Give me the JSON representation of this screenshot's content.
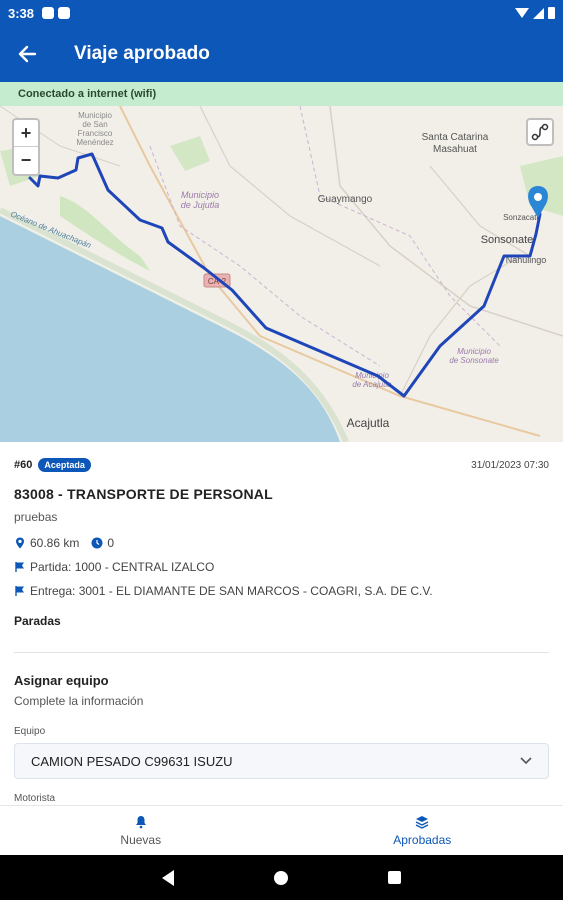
{
  "status": {
    "time": "3:38"
  },
  "header": {
    "title": "Viaje aprobado"
  },
  "connection": {
    "text": "Conectado a internet (wifi)"
  },
  "map": {
    "zoom_in": "+",
    "zoom_out": "−",
    "labels": {
      "san_francisco": "Municipio\nde San\nFrancisco\nMenéndez",
      "jujutla": "Municipio\nde Jujutla",
      "guaymango": "Guaymango",
      "santa_catarina": "Santa Catarina\nMasahuat",
      "sonzacate": "Sonzacate",
      "sonsonate": "Sonsonate",
      "nahulingo": "Nahulingo",
      "acajutla_muni": "Municipio\nde Acajutla",
      "acajutla": "Acajutla",
      "sonsonate_muni": "Municipio\nde Sonsonate",
      "ca2": "CA-2",
      "ocean": "Océano de Ahuachapán"
    }
  },
  "trip": {
    "id": "#60",
    "status": "Aceptada",
    "date": "31/01/2023 07:30",
    "title": "83008 - TRANSPORTE DE PERSONAL",
    "subtitle": "pruebas",
    "distance": "60.86 km",
    "duration": "0",
    "departure": "Partida: 1000 - CENTRAL IZALCO",
    "delivery": "Entrega: 3001 - EL DIAMANTE DE SAN MARCOS - COAGRI, S.A. DE C.V.",
    "stops_label": "Paradas"
  },
  "assign": {
    "title": "Asignar equipo",
    "subtitle": "Complete la información",
    "equipment_label": "Equipo",
    "equipment_value": "CAMION PESADO C99631 ISUZU",
    "driver_label": "Motorista"
  },
  "nav": {
    "new": "Nuevas",
    "approved": "Aprobadas"
  },
  "colors": {
    "primary": "#0d57b8",
    "connection_bg": "#c6ecd0",
    "route": "#1f46b8"
  }
}
